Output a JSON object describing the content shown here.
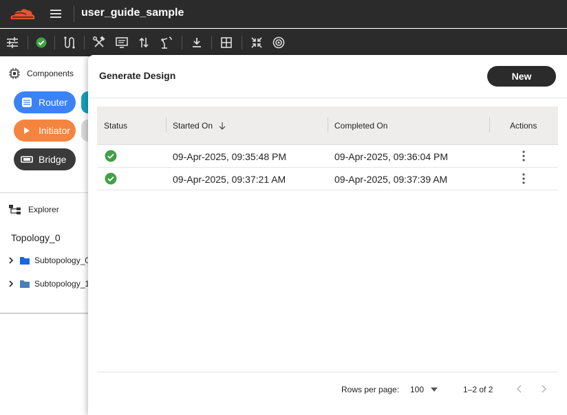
{
  "header": {
    "title": "user_guide_sample"
  },
  "toolbar": {
    "icons": [
      "tune-icon",
      "check-circle-icon",
      "route-icon",
      "tools-icon",
      "monitor-icon",
      "swap-vert-icon",
      "robot-arm-icon",
      "download-icon",
      "grid-icon",
      "collapse-icon",
      "target-icon"
    ]
  },
  "left_panel": {
    "components_label": "Components",
    "chips": [
      {
        "label": "Router",
        "color": "#3b82f6"
      },
      {
        "label": "Initiator",
        "color": "#f5843f"
      },
      {
        "label": "Bridge",
        "color": "#3a3a3a"
      }
    ],
    "explorer_label": "Explorer",
    "tree": {
      "root": "Topology_0",
      "items": [
        {
          "label": "Subtopology_0"
        },
        {
          "label": "Subtopology_1"
        }
      ]
    }
  },
  "dialog": {
    "title": "Generate Design",
    "new_button": "New",
    "table": {
      "headers": {
        "status": "Status",
        "started": "Started On",
        "completed": "Completed On",
        "actions": "Actions"
      },
      "rows": [
        {
          "status": "success",
          "started": "09-Apr-2025, 09:35:48 PM",
          "completed": "09-Apr-2025, 09:36:04 PM"
        },
        {
          "status": "success",
          "started": "09-Apr-2025, 09:37:21 AM",
          "completed": "09-Apr-2025, 09:37:39 AM"
        }
      ]
    },
    "footer": {
      "rows_per_page_label": "Rows per page:",
      "rows_per_page_value": "100",
      "range": "1–2 of 2"
    }
  },
  "colors": {
    "success": "#43a047",
    "accent_cyan": "#17a2b8",
    "dark": "#2b2b2b"
  }
}
